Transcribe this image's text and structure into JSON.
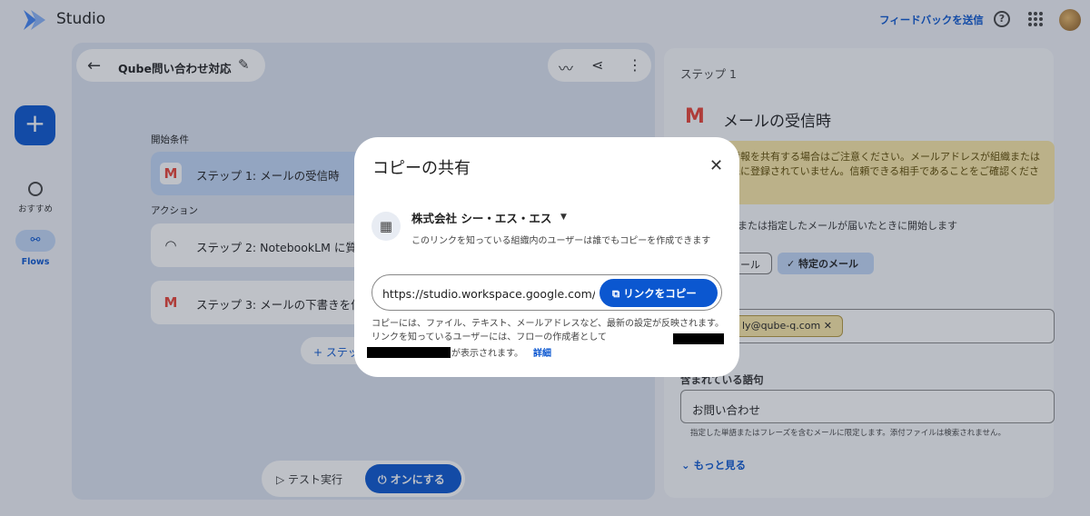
{
  "app": {
    "name": "Studio",
    "feedback": "フィードバックを送信",
    "help_glyph": "?"
  },
  "sidebar": {
    "create_glyph": "+",
    "items": [
      {
        "label": "おすすめ",
        "icon": "compass-icon"
      },
      {
        "label": "Flows",
        "icon": "flows-icon"
      }
    ]
  },
  "flow": {
    "name": "Qube問い合わせ対応",
    "start_label": "開始条件",
    "action_label": "アクション",
    "steps": [
      {
        "text": "ステップ 1: メールの受信時",
        "icon": "gmail-icon"
      },
      {
        "text": "ステップ 2: NotebookLM に質問",
        "icon": "notebooklm-icon"
      },
      {
        "text": "ステップ 3: メールの下書きを作成",
        "icon": "gmail-icon"
      }
    ],
    "add_step": "+ ステップ",
    "test_run": "テスト実行",
    "turn_on": "オンにする"
  },
  "right_panel": {
    "step_label": "ステップ 1",
    "title": "メールの受信時",
    "warning": "情報を共有する場合はご注意ください。メールアドレスが組織または 先に登録されていません。信頼できる相手であることをご確認くださ",
    "condition": "または指定したメールが届いたときに開始します",
    "chip_all": "ール",
    "chip_specific": "特定のメール",
    "email_chip": "ly@qube-q.com",
    "keyword_label": "含まれている語句",
    "keyword_value": "お問い合わせ",
    "keyword_help": "指定した単語またはフレーズを含むメールに限定します。添付ファイルは検索されません。",
    "more": "もっと見る"
  },
  "dialog": {
    "title": "コピーの共有",
    "org_name": "株式会社 シー・エス・エス",
    "org_desc": "このリンクを知っている組織内のユーザーは誰でもコピーを作成できます",
    "link": "https://studio.workspace.google.com/u/0/",
    "copy_button": "リンクをコピー",
    "note": "コピーには、ファイル、テキスト、メールアドレスなど、最新の設定が反映されます。 リンクを知っているユーザーには、フローの作成者として",
    "note_tail": "が表示されます。",
    "details_link": "詳細"
  },
  "colors": {
    "accent": "#0b57d0",
    "warning_bg": "#fbe8a6",
    "active_step": "#c2d7f7",
    "gmail_red": "#ea4335"
  }
}
